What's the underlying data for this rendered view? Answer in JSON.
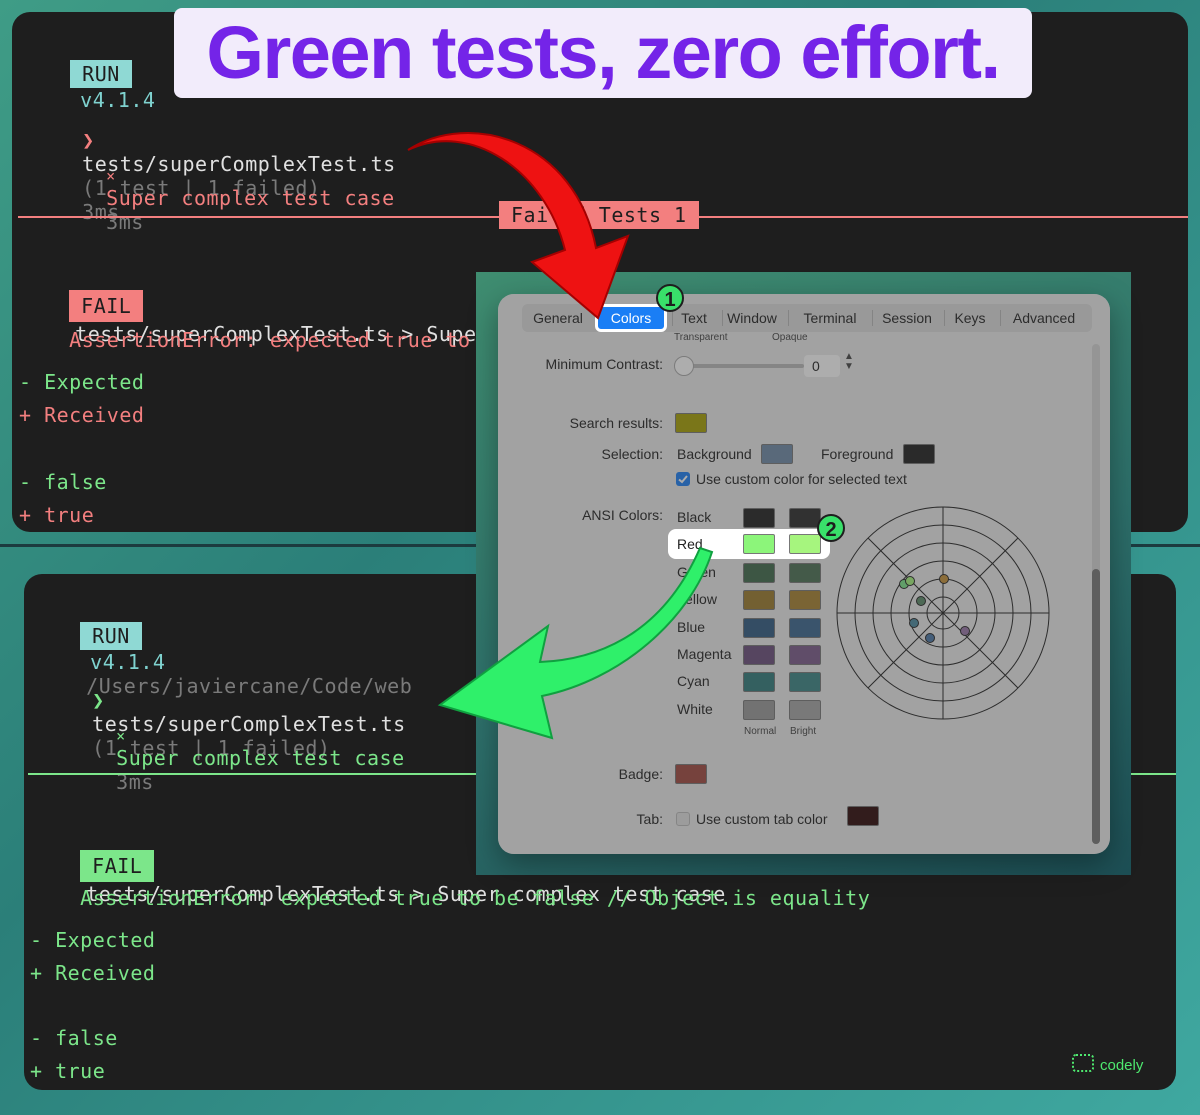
{
  "headline": "Green tests, zero effort.",
  "top_terminal": {
    "run_tag": "RUN",
    "version": "v4.1.4",
    "arrow": "❯",
    "file": "tests/superComplexTest.ts",
    "summary": "(1 test | 1 failed)",
    "duration": "3ms",
    "case_mark": "×",
    "case_name": "Super complex test case",
    "case_duration": "3ms",
    "failed_banner": "Failed Tests 1",
    "fail_tag": "FAIL",
    "fail_path": "tests/superComplexTest.ts > Super complex test case",
    "assertion_name": "AssertionError",
    "assertion_rest": ": expected true to be false // Object.is equality",
    "expected_line": "- Expected",
    "received_line": "+ Received",
    "false_line": "- false",
    "true_line": "+ true",
    "accent": "#f37f7f"
  },
  "bottom_terminal": {
    "run_tag": "RUN",
    "version": "v4.1.4",
    "path": "/Users/javiercane/Code/web",
    "arrow": "❯",
    "file": "tests/superComplexTest.ts",
    "summary": "(1 test | 1 failed)",
    "case_mark": "×",
    "case_name": "Super complex test case",
    "case_duration": "3ms",
    "fail_tag": "FAIL",
    "fail_path": "tests/superComplexTest.ts > Super complex test case",
    "assertion_name": "AssertionError",
    "assertion_rest": ": expected true to be false // Object.is equality",
    "expected_line": "- Expected",
    "received_line": "+ Received",
    "false_line": "- false",
    "true_line": "+ true",
    "accent": "#7ce68a"
  },
  "prefs": {
    "tabs": [
      "General",
      "Colors",
      "Text",
      "Window",
      "Terminal",
      "Session",
      "Keys",
      "Advanced"
    ],
    "active_tab": "Colors",
    "transparent_label": "Transparent",
    "opaque_label": "Opaque",
    "min_contrast_label": "Minimum Contrast:",
    "min_contrast_value": "0",
    "search_results_label": "Search results:",
    "selection_label": "Selection:",
    "background_label": "Background",
    "foreground_label": "Foreground",
    "custom_selected_label": "Use custom color for selected text",
    "custom_selected_checked": true,
    "ansi_label": "ANSI Colors:",
    "ansi_rows": [
      {
        "name": "Black",
        "normal": "#1f1f1f",
        "bright": "#2a2a2a"
      },
      {
        "name": "Red",
        "normal": "#8cf57a",
        "bright": "#a6f57e"
      },
      {
        "name": "Green",
        "normal": "#3f6a4a",
        "bright": "#4a7054"
      },
      {
        "name": "Yellow",
        "normal": "#9c7a2c",
        "bright": "#a8822f"
      },
      {
        "name": "Blue",
        "normal": "#2f5a82",
        "bright": "#3a6690"
      },
      {
        "name": "Magenta",
        "normal": "#6a4d7a",
        "bright": "#7a5b8a"
      },
      {
        "name": "Cyan",
        "normal": "#2f7a7a",
        "bright": "#3a8686"
      },
      {
        "name": "White",
        "normal": "#9a9a9a",
        "bright": "#a6a6a6"
      }
    ],
    "normal_label": "Normal",
    "bright_label": "Bright",
    "badge_label": "Badge:",
    "tab_label": "Tab:",
    "custom_tab_label": "Use custom tab color",
    "custom_tab_checked": false,
    "colors": {
      "search_results": "#a8a000",
      "selection_bg": "#6f8aa8",
      "selection_fg": "#1e1e1e",
      "badge": "#a0483e",
      "tab_color": "#2b0606",
      "accent": "#1a7ef5"
    },
    "step_1": "1",
    "step_2": "2"
  },
  "brand": "codely"
}
